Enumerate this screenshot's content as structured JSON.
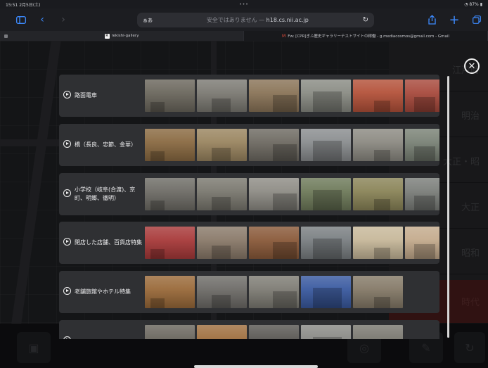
{
  "status_bar": {
    "time_date": "15:51  2月5日(土)",
    "center_dots": "•••",
    "battery": "87%"
  },
  "browser": {
    "aa_label": "ぁあ",
    "url_warning": "安全ではありません — ",
    "url_host": "h18.cs.nii.ac.jp",
    "tabs": [
      {
        "title": "rekishi-gallery",
        "icon": "page-icon"
      },
      {
        "title": "Fw: [CPR]ぎふ歴史ギャラリーテストサイトの稼働 - g.mediacosmos@gmail.com - Gmail",
        "icon": "gmail-icon"
      }
    ]
  },
  "background_panel": {
    "items": [
      "江戸時",
      "明治",
      "大正・昭",
      "大正",
      "昭和",
      "時代"
    ]
  },
  "gallery": {
    "rows": [
      {
        "label": "路面電車",
        "thumbs": [
          "#6b675d",
          "#7c7a73",
          "#8a7458",
          "#8a8c84",
          "#b4523a",
          "#a84a3d"
        ]
      },
      {
        "label": "橋（長良、忠節、金華）",
        "thumbs": [
          "#8a6a42",
          "#9a8560",
          "#6e6a62",
          "#8a8d8f",
          "#8c8a82",
          "#7a8276"
        ]
      },
      {
        "label": "小学校（岐阜(合渡)、京町、明郷、徹明）",
        "thumbs": [
          "#6e6c66",
          "#7a786f",
          "#8e8c85",
          "#6e7a5a",
          "#8a8458",
          "#7b7e7a"
        ]
      },
      {
        "label": "閉店した店舗、百貨店特集",
        "thumbs": [
          "#a83a3a",
          "#8a7a6a",
          "#8a5a3a",
          "#7a7f82",
          "#c7b89a",
          "#c4ab8d"
        ]
      },
      {
        "label": "老舗旅館やホテル特集",
        "thumbs": [
          "#9a6a3a",
          "#6e6c68",
          "#7e7c74",
          "#3a5aa0",
          "#857a68"
        ]
      },
      {
        "label": "",
        "thumbs": [
          "#6a665e",
          "#a07040",
          "#5a5854",
          "#8a8a86",
          "#7a7870"
        ]
      }
    ]
  }
}
